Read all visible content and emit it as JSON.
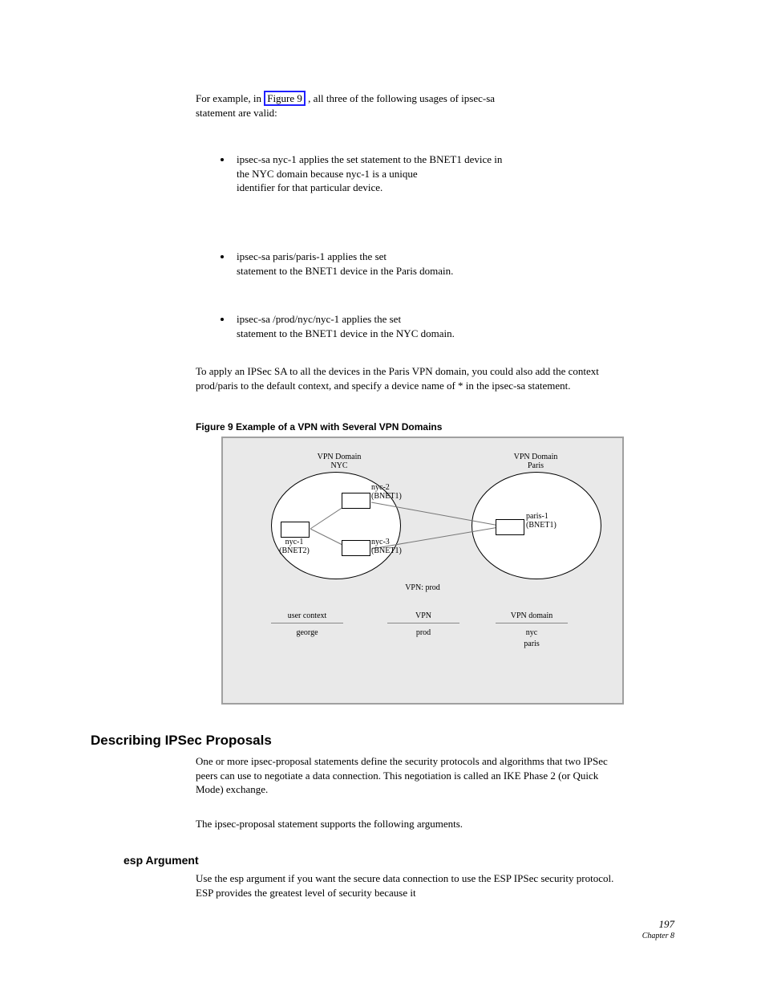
{
  "intro_sentence_with_ref": {
    "pre": "For example, in ",
    "ref": "Figure 9",
    "post": ", all three of the following usages of ",
    "code1": "ipsec-sa",
    "tail": " statement are valid:"
  },
  "bullets": [
    {
      "code": "ipsec-sa nyc-1",
      "text_lines": [
        "applies the set statement to the BNET1 device in",
        "the NYC domain because nyc-1 is a unique",
        "identifier for that particular device."
      ]
    },
    {
      "code": "ipsec-sa paris/paris-1",
      "text_lines": [
        "applies the set",
        "statement to the BNET1 device in the Paris domain."
      ]
    },
    {
      "code": "ipsec-sa /prod/nyc/nyc-1",
      "text_lines": [
        "applies the set",
        "statement to the BNET1 device in the NYC domain."
      ]
    }
  ],
  "paragraph_after_bullets": "To apply an IPSec SA to all the devices in the Paris VPN domain, you could also add the context prod/paris to the default context, and specify a device name of * in the ipsec-sa statement.",
  "figure": {
    "caption": "Figure 9   Example of a VPN with Several VPN Domains",
    "vpn_label_nyc": "VPN Domain\nNYC",
    "vpn_label_paris": "VPN Domain\nParis",
    "nodes": {
      "nyc1": "nyc-1\n(BNET2)",
      "nyc2": "nyc-2\n(BNET1)",
      "nyc3": "nyc-3\n(BNET1)",
      "paris1": "paris-1\n(BNET1)"
    },
    "vpn_footer": "VPN: prod",
    "columns": {
      "header_left": "user context",
      "header_mid": "VPN",
      "header_right": "VPN domain",
      "row1_left": "george",
      "row1_mid": "prod",
      "row1_right": "nyc",
      "row2_left": "",
      "row2_mid": "",
      "row2_right": "paris"
    }
  },
  "section_heading": "Describing IPSec Proposals",
  "section_para_1_pre": "One or more ",
  "section_para_1_code": "ipsec-proposal",
  "section_para_1_post": " statements define the security protocols and algorithms that two IPSec peers can use to negotiate a data connection. This negotiation is called an IKE Phase 2 (or Quick Mode) exchange.",
  "section_para_2_pre": "The ",
  "section_para_2_code": "ipsec-proposal",
  "section_para_2_post": " statement supports the following arguments.",
  "bottom_heading": "esp Argument",
  "bottom_para_pre": "Use the ",
  "bottom_para_code": "esp",
  "bottom_para_mid": " argument if you want the secure data connection to use the ESP IPSec security protocol. ESP provides the greatest level of security because it",
  "page_number": "197",
  "footer_chapter": "Chapter 8"
}
